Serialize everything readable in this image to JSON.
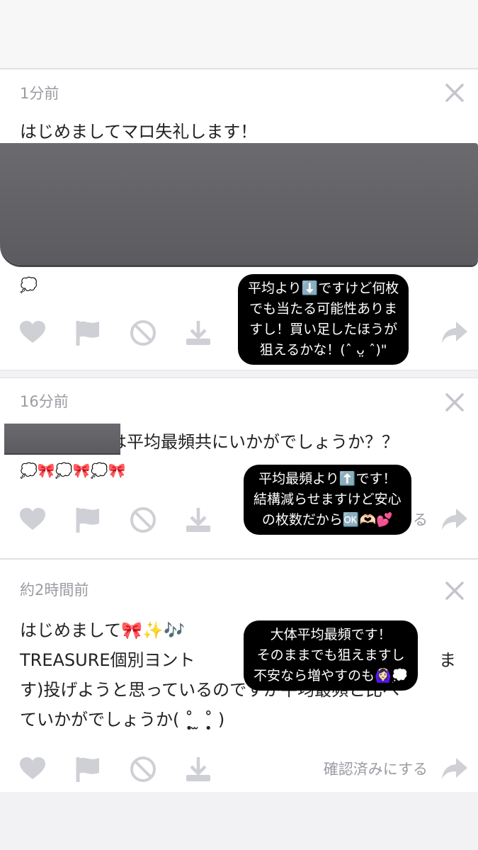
{
  "cards": [
    {
      "time": "1分前",
      "message": "はじめましてマロ失礼します！",
      "emoji_row": "💭",
      "overlay_lines": [
        "平均より⬇️ですけど何枚",
        "でも当たる可能性ありま",
        "すし！買い足したほうが",
        "狙えるかな！(ˆ ᴗ̤ ˆ)\""
      ]
    },
    {
      "time": "16分前",
      "message_tail": "は平均最頻共にいかがでしょうか？？",
      "emoji_row": "💭🎀💭🎀💭🎀",
      "partial_confirm": "る",
      "overlay_lines": [
        "平均最頻より⬆️です！",
        "結構減らせますけど安心",
        "の枚数だから🆗🫶🏻💕"
      ]
    },
    {
      "time": "約2時間前",
      "message_lines": [
        "はじめまして🎀✨🎶",
        "TREASURE個別ヨント",
        "す)投げようと思っているのですが平均最頻と比べ",
        "ていかがでしょうか( ˚̩̥̩̥ ̫ ˚̩̥̩̥ )"
      ],
      "message_line2_tail": "ま",
      "confirm": "確認済みにする",
      "overlay_lines": [
        "大体平均最頻です！",
        "そのままでも狙えますし",
        "不安なら増やすのも🙆🏻‍♀️💭"
      ]
    }
  ],
  "icons": {
    "like": "heart-icon",
    "flag": "flag-icon",
    "block": "block-icon",
    "download": "download-icon",
    "share": "share-arrow-icon",
    "close": "close-icon"
  },
  "colors": {
    "icon": "#cfcfd6",
    "meta_text": "#9b9ba3",
    "overlay_bg": "#000000",
    "redaction": "#626267"
  }
}
